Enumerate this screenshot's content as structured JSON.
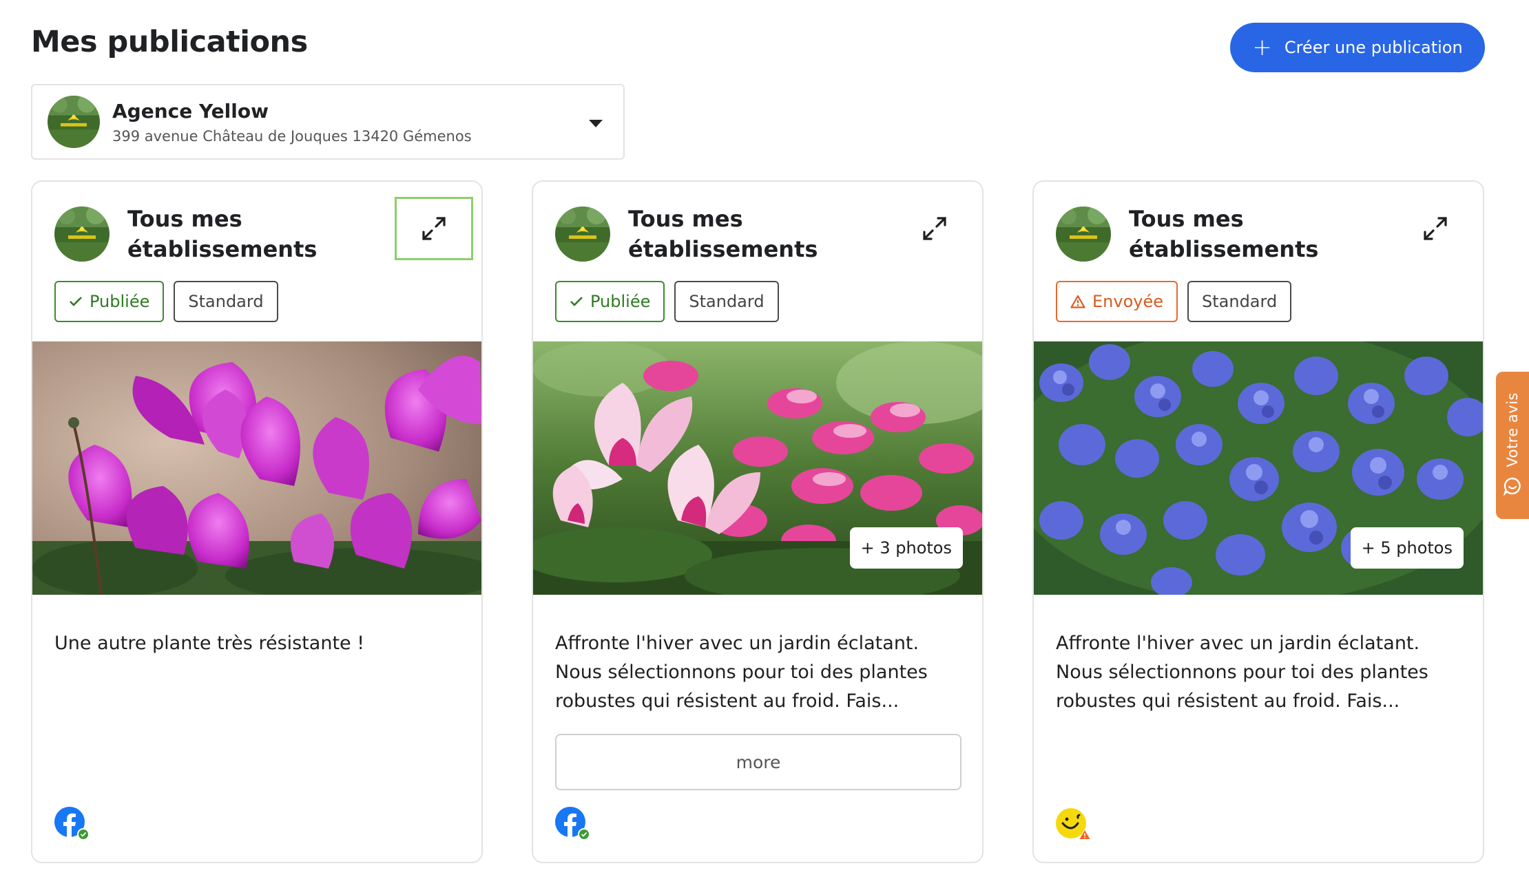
{
  "header": {
    "title": "Mes publications",
    "create_label": "Créer une publication"
  },
  "selector": {
    "name": "Agence Yellow",
    "address": "399 avenue Château de Jouques 13420 Gémenos"
  },
  "cards": [
    {
      "title": "Tous mes établissements",
      "status": "Publiée",
      "type": "Standard",
      "photo_count": "",
      "text": "Une autre plante très résistante !",
      "more_label": "",
      "network_icon": "facebook-icon",
      "network_status": "ok"
    },
    {
      "title": "Tous mes établissements",
      "status": "Publiée",
      "type": "Standard",
      "photo_count": "+ 3 photos",
      "text": "Affronte l'hiver avec un jardin éclatant. Nous sélectionnons pour toi des plantes robustes qui résistent au froid. Fais...",
      "more_label": "more",
      "network_icon": "facebook-icon",
      "network_status": "ok"
    },
    {
      "title": "Tous mes établissements",
      "status": "Envoyée",
      "type": "Standard",
      "photo_count": "+ 5 photos",
      "text": "Affronte l'hiver avec un jardin éclatant. Nous sélectionnons pour toi des plantes robustes qui résistent au froid. Fais...",
      "more_label": "",
      "network_icon": "smiley-icon",
      "network_status": "warning"
    }
  ],
  "feedback": {
    "label": "Votre avis"
  },
  "colors": {
    "primary": "#2866e6",
    "published": "#2f7a22",
    "sent": "#d95a1c",
    "feedback": "#e8863f",
    "focus": "#8ccf6c"
  }
}
